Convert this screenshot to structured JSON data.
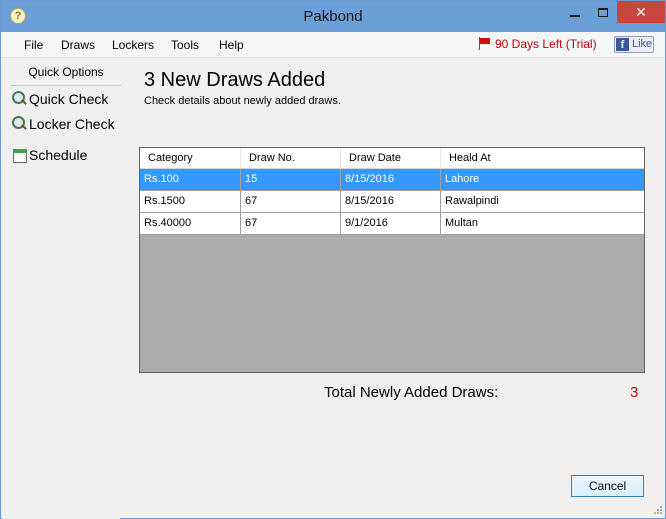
{
  "window": {
    "title": "Pakbond",
    "close_symbol": "✕",
    "app_icon_glyph": "?"
  },
  "menu": {
    "items": [
      "File",
      "Draws",
      "Lockers",
      "Tools",
      "Help"
    ],
    "trial_text": "90 Days Left (Trial)",
    "like_text": "Like",
    "like_logo": "f"
  },
  "sidebar": {
    "header": "Quick Options",
    "items": [
      {
        "label": "Quick Check",
        "icon": "magnifier-icon"
      },
      {
        "label": "Locker Check",
        "icon": "magnifier-icon"
      },
      {
        "label": "Schedule",
        "icon": "calendar-icon"
      }
    ]
  },
  "main": {
    "title": "3 New Draws Added",
    "subtitle": "Check details about newly added draws.",
    "table": {
      "columns": [
        "Category",
        "Draw No.",
        "Draw Date",
        "Heald At"
      ],
      "rows": [
        [
          "Rs.100",
          "15",
          "8/15/2016",
          "Lahore"
        ],
        [
          "Rs.1500",
          "67",
          "8/15/2016",
          "Rawalpindi"
        ],
        [
          "Rs.40000",
          "67",
          "9/1/2016",
          "Multan"
        ]
      ],
      "selected_row": 0
    },
    "total_label": "Total Newly Added Draws:",
    "total_value": "3",
    "cancel_label": "Cancel"
  },
  "colors": {
    "titlebar": "#6b9fd8",
    "selection": "#3399ff",
    "trial_red": "#c00000",
    "total_red": "#d00000",
    "close_button": "#c7463e"
  }
}
